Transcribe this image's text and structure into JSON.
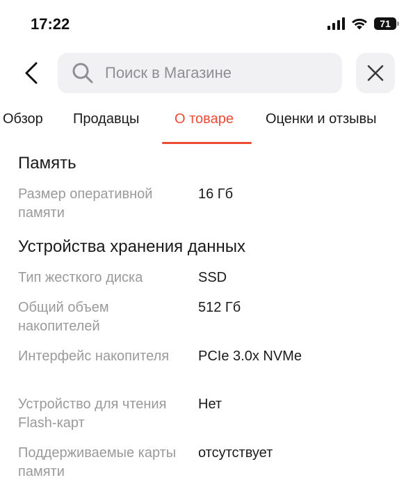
{
  "status_bar": {
    "time": "17:22",
    "battery": "71",
    "icons": [
      "signal-icon",
      "wifi-icon",
      "battery-icon"
    ]
  },
  "top_bar": {
    "back_icon": "chevron-left-icon",
    "search_placeholder": "Поиск в Магазине",
    "close_icon": "close-icon"
  },
  "tabs": [
    {
      "label": "Обзор",
      "active": false
    },
    {
      "label": "Продавцы",
      "active": false
    },
    {
      "label": "О товаре",
      "active": true
    },
    {
      "label": "Оценки и отзывы",
      "active": false
    }
  ],
  "accent_color": "#ef4a32",
  "sections": [
    {
      "title": "Память",
      "specs": [
        {
          "label": "Размер оперативной памяти",
          "value": "16 Гб"
        }
      ]
    },
    {
      "title": "Устройства хранения данных",
      "specs": [
        {
          "label": "Тип жесткого диска",
          "value": "SSD"
        },
        {
          "label": "Общий объем накопителей",
          "value": "512 Гб"
        },
        {
          "label": "Интерфейс накопителя",
          "value": "PCIe 3.0x NVMe"
        },
        {
          "label": "Устройство для чтения Flash-карт",
          "value": "Нет"
        },
        {
          "label": "Поддерживаемые карты памяти",
          "value": "отсутствует"
        }
      ]
    }
  ]
}
